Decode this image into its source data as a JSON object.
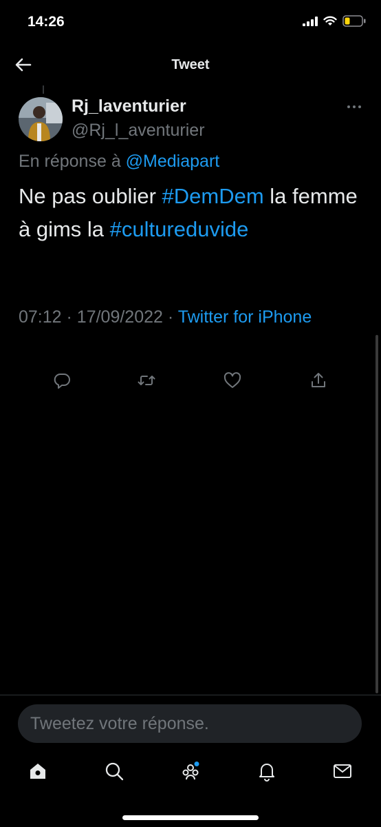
{
  "status_bar": {
    "time": "14:26",
    "icons": [
      "signal-icon",
      "wifi-icon",
      "battery-icon"
    ]
  },
  "header": {
    "title": "Tweet",
    "back_icon": "arrow-left-icon"
  },
  "tweet": {
    "author_name": "Rj_laventurier",
    "author_handle": "@Rj_l_aventurier",
    "reply_prefix": "En réponse à",
    "reply_to": "@Mediapart",
    "text_part1": "Ne pas oublier ",
    "hashtag1": "#DemDem",
    "text_part2": " la femme à gims la ",
    "hashtag2": "#cultureduvide",
    "time": "07:12",
    "date": "17/09/2022",
    "separator": "·",
    "source": "Twitter for iPhone",
    "actions": [
      "reply-icon",
      "retweet-icon",
      "like-icon",
      "share-icon"
    ]
  },
  "reply": {
    "placeholder": "Tweetez votre réponse."
  },
  "tabbar": {
    "items": [
      "home-icon",
      "search-icon",
      "communities-icon",
      "notifications-icon",
      "messages-icon"
    ]
  },
  "colors": {
    "background": "#000000",
    "accent": "#1d9bf0",
    "secondary_text": "#71767b",
    "primary_text": "#e7e9ea"
  }
}
